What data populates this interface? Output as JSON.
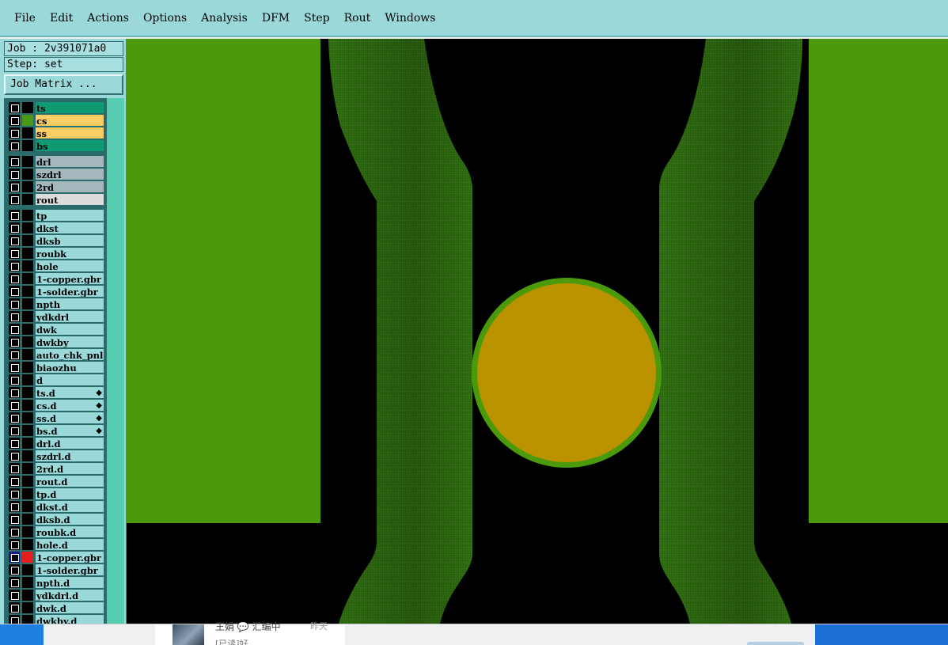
{
  "menu": {
    "items": [
      "File",
      "Edit",
      "Actions",
      "Options",
      "Analysis",
      "DFM",
      "Step",
      "Rout",
      "Windows"
    ]
  },
  "panel": {
    "job": "Job : 2v391071a0",
    "step": "Step: set",
    "job_matrix_button": "Job Matrix ..."
  },
  "layers": [
    {
      "name": "ts",
      "color": "#0e9a72",
      "swatch": "#000000",
      "group": 0
    },
    {
      "name": "cs",
      "color": "#ffcc66",
      "swatch": "#4a9a18",
      "group": 0
    },
    {
      "name": "ss",
      "color": "#ffcc66",
      "swatch": "#000000",
      "group": 0
    },
    {
      "name": "bs",
      "color": "#0e9a72",
      "swatch": "#000000",
      "group": 0
    },
    {
      "name": "drl",
      "color": "#a3b7bd",
      "swatch": "#000000",
      "group": 1
    },
    {
      "name": "szdrl",
      "color": "#a3b7bd",
      "swatch": "#000000",
      "group": 1
    },
    {
      "name": "2rd",
      "color": "#a3b7bd",
      "swatch": "#000000",
      "group": 1
    },
    {
      "name": "rout",
      "color": "#dcdcdc",
      "swatch": "#000000",
      "group": 1
    },
    {
      "name": "tp",
      "color": "#9bd8da",
      "swatch": "#000000",
      "group": 2
    },
    {
      "name": "dkst",
      "color": "#9bd8da",
      "swatch": "#000000",
      "group": 2
    },
    {
      "name": "dksb",
      "color": "#9bd8da",
      "swatch": "#000000",
      "group": 2
    },
    {
      "name": "roubk",
      "color": "#9bd8da",
      "swatch": "#000000",
      "group": 2
    },
    {
      "name": "hole",
      "color": "#9bd8da",
      "swatch": "#000000",
      "group": 2
    },
    {
      "name": "1-copper.gbr",
      "color": "#9bd8da",
      "swatch": "#000000",
      "group": 2
    },
    {
      "name": "1-solder.gbr",
      "color": "#9bd8da",
      "swatch": "#000000",
      "group": 2
    },
    {
      "name": "npth",
      "color": "#9bd8da",
      "swatch": "#000000",
      "group": 2
    },
    {
      "name": "ydkdrl",
      "color": "#9bd8da",
      "swatch": "#000000",
      "group": 2
    },
    {
      "name": "dwk",
      "color": "#9bd8da",
      "swatch": "#000000",
      "group": 2
    },
    {
      "name": "dwkby",
      "color": "#9bd8da",
      "swatch": "#000000",
      "group": 2
    },
    {
      "name": "auto_chk_pnl",
      "color": "#9bd8da",
      "swatch": "#000000",
      "group": 2
    },
    {
      "name": "biaozhu",
      "color": "#9bd8da",
      "swatch": "#000000",
      "group": 2
    },
    {
      "name": "d",
      "color": "#9bd8da",
      "swatch": "#000000",
      "group": 2
    },
    {
      "name": "ts.d",
      "color": "#9bd8da",
      "swatch": "#000000",
      "group": 2,
      "flag": true
    },
    {
      "name": "cs.d",
      "color": "#9bd8da",
      "swatch": "#000000",
      "group": 2,
      "flag": true
    },
    {
      "name": "ss.d",
      "color": "#9bd8da",
      "swatch": "#000000",
      "group": 2,
      "flag": true
    },
    {
      "name": "bs.d",
      "color": "#9bd8da",
      "swatch": "#000000",
      "group": 2,
      "flag": true
    },
    {
      "name": "drl.d",
      "color": "#9bd8da",
      "swatch": "#000000",
      "group": 2
    },
    {
      "name": "szdrl.d",
      "color": "#9bd8da",
      "swatch": "#000000",
      "group": 2
    },
    {
      "name": "2rd.d",
      "color": "#9bd8da",
      "swatch": "#000000",
      "group": 2
    },
    {
      "name": "rout.d",
      "color": "#9bd8da",
      "swatch": "#000000",
      "group": 2
    },
    {
      "name": "tp.d",
      "color": "#9bd8da",
      "swatch": "#000000",
      "group": 2
    },
    {
      "name": "dkst.d",
      "color": "#9bd8da",
      "swatch": "#000000",
      "group": 2
    },
    {
      "name": "dksb.d",
      "color": "#9bd8da",
      "swatch": "#000000",
      "group": 2
    },
    {
      "name": "roubk.d",
      "color": "#9bd8da",
      "swatch": "#000000",
      "group": 2
    },
    {
      "name": "hole.d",
      "color": "#9bd8da",
      "swatch": "#000000",
      "group": 2
    },
    {
      "name": "1-copper.gbr",
      "color": "#9bd8da",
      "swatch": "#e81e1e",
      "group": 2,
      "selected": true
    },
    {
      "name": "1-solder.gbr",
      "color": "#9bd8da",
      "swatch": "#000000",
      "group": 2
    },
    {
      "name": "npth.d",
      "color": "#9bd8da",
      "swatch": "#000000",
      "group": 2
    },
    {
      "name": "ydkdrl.d",
      "color": "#9bd8da",
      "swatch": "#000000",
      "group": 2
    },
    {
      "name": "dwk.d",
      "color": "#9bd8da",
      "swatch": "#000000",
      "group": 2
    },
    {
      "name": "dwkby.d",
      "color": "#9bd8da",
      "swatch": "#000000",
      "group": 2
    }
  ],
  "canvas": {
    "copper_color": "#4a9a0c",
    "trace_color": "#2f6b12",
    "pad_color": "#bb9200",
    "pad_ring_color": "#4a9a0c"
  },
  "taskbar": {
    "name": "王娟 💬 汇编中",
    "time": "昨天",
    "subtext": "[已读]好"
  }
}
